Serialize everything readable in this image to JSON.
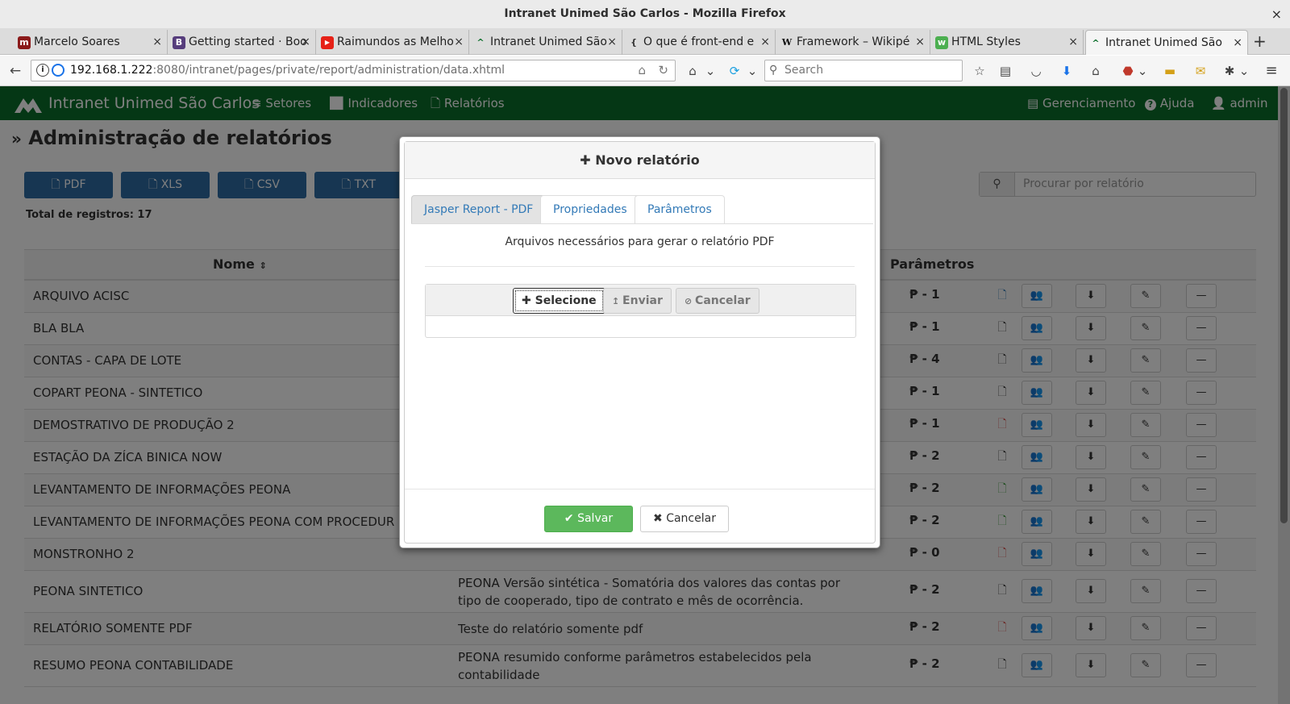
{
  "window": {
    "title": "Intranet Unimed São Carlos - Mozilla Firefox",
    "close": "×"
  },
  "tabs": [
    {
      "label": "Marcelo Soares",
      "color": "#c0392b",
      "glyph": "m"
    },
    {
      "label": "Getting started · Boo",
      "color": "#563d7c",
      "glyph": "B"
    },
    {
      "label": "Raimundos as Melho",
      "color": "#e62117",
      "glyph": "▶"
    },
    {
      "label": "Intranet Unimed São",
      "color": "#0a6e2a",
      "glyph": "^"
    },
    {
      "label": "O que é front-end e",
      "color": "#ffffff",
      "glyph": "{"
    },
    {
      "label": "Framework – Wikipé",
      "color": "#ffffff",
      "glyph": "W"
    },
    {
      "label": "HTML Styles",
      "color": "#4caf50",
      "glyph": "w"
    },
    {
      "label": "Intranet Unimed São",
      "color": "#0a6e2a",
      "glyph": "^"
    }
  ],
  "tab_close": "×",
  "new_tab": "+",
  "url": {
    "host": "192.168.1.222",
    "rest": ":8080/intranet/pages/private/report/administration/data.xhtml"
  },
  "search": {
    "placeholder": "Search"
  },
  "app": {
    "brand": "Intranet Unimed São Carlos",
    "menu": [
      {
        "label": "Setores",
        "icon": "≡"
      },
      {
        "label": "Indicadores",
        "icon": "📈"
      },
      {
        "label": "Relatórios",
        "icon": "🗋"
      }
    ],
    "right_menu": [
      {
        "label": "Gerenciamento",
        "icon": "▤"
      },
      {
        "label": "Ajuda",
        "icon": "?"
      },
      {
        "label": "admin",
        "icon": "👤"
      }
    ]
  },
  "page": {
    "title": "Administração de relatórios",
    "export_buttons": [
      "PDF",
      "XLS",
      "CSV",
      "TXT"
    ],
    "search_placeholder": "Procurar por relatório",
    "total": "Total de registros: 17",
    "col_name": "Nome",
    "col_params": "Parâmetros",
    "rows": [
      {
        "name": "ARQUIVO ACISC",
        "desc": "",
        "params": "₱ - 1",
        "icon_color": "#337ab7"
      },
      {
        "name": "BLA BLA",
        "desc": "",
        "params": "₱ - 1",
        "icon_color": "#333333"
      },
      {
        "name": "CONTAS - CAPA DE LOTE",
        "desc": "",
        "params": "₱ - 4",
        "icon_color": "#333333"
      },
      {
        "name": "COPART PEONA - SINTETICO",
        "desc": "",
        "params": "₱ - 1",
        "icon_color": "#333333"
      },
      {
        "name": "DEMOSTRATIVO DE PRODUÇÃO 2",
        "desc": "",
        "params": "₱ - 1",
        "icon_color": "#d9534f"
      },
      {
        "name": "ESTAÇÃO DA ZÍCA BINICA NOW",
        "desc": "",
        "params": "₱ - 2",
        "icon_color": "#333333"
      },
      {
        "name": "LEVANTAMENTO DE INFORMAÇÕES PEONA",
        "desc": "",
        "params": "₱ - 2",
        "icon_color": "#3c9b3c"
      },
      {
        "name": "LEVANTAMENTO DE INFORMAÇÕES PEONA COM PROCEDUR",
        "desc": "",
        "params": "₱ - 2",
        "icon_color": "#3c9b3c"
      },
      {
        "name": "MONSTRONHO 2",
        "desc": "",
        "params": "₱ - 0",
        "icon_color": "#d9534f"
      },
      {
        "name": "PEONA SINTETICO",
        "desc": "PEONA Versão sintética - Somatória dos valores das contas por tipo de cooperado, tipo de contrato e mês de ocorrência.",
        "params": "₱ - 2",
        "icon_color": "#333333"
      },
      {
        "name": "RELATÓRIO SOMENTE PDF",
        "desc": "Teste do relatório somente pdf",
        "params": "₱ - 2",
        "icon_color": "#d9534f"
      },
      {
        "name": "RESUMO PEONA CONTABILIDADE",
        "desc": "PEONA resumido conforme parâmetros estabelecidos pela contabilidade",
        "params": "₱ - 2",
        "icon_color": "#333333"
      }
    ]
  },
  "modal": {
    "title": "Novo relatório",
    "tabs": [
      "Jasper Report - PDF",
      "Propriedades",
      "Parâmetros"
    ],
    "lead": "Arquivos necessários para gerar o relatório PDF",
    "upload": {
      "select": "Selecione",
      "send": "Enviar",
      "cancel": "Cancelar"
    },
    "save": "Salvar",
    "cancel": "Cancelar"
  },
  "colors": {
    "brand_green": "#0a6e2a",
    "primary": "#337ab7",
    "success": "#5cb85c"
  }
}
